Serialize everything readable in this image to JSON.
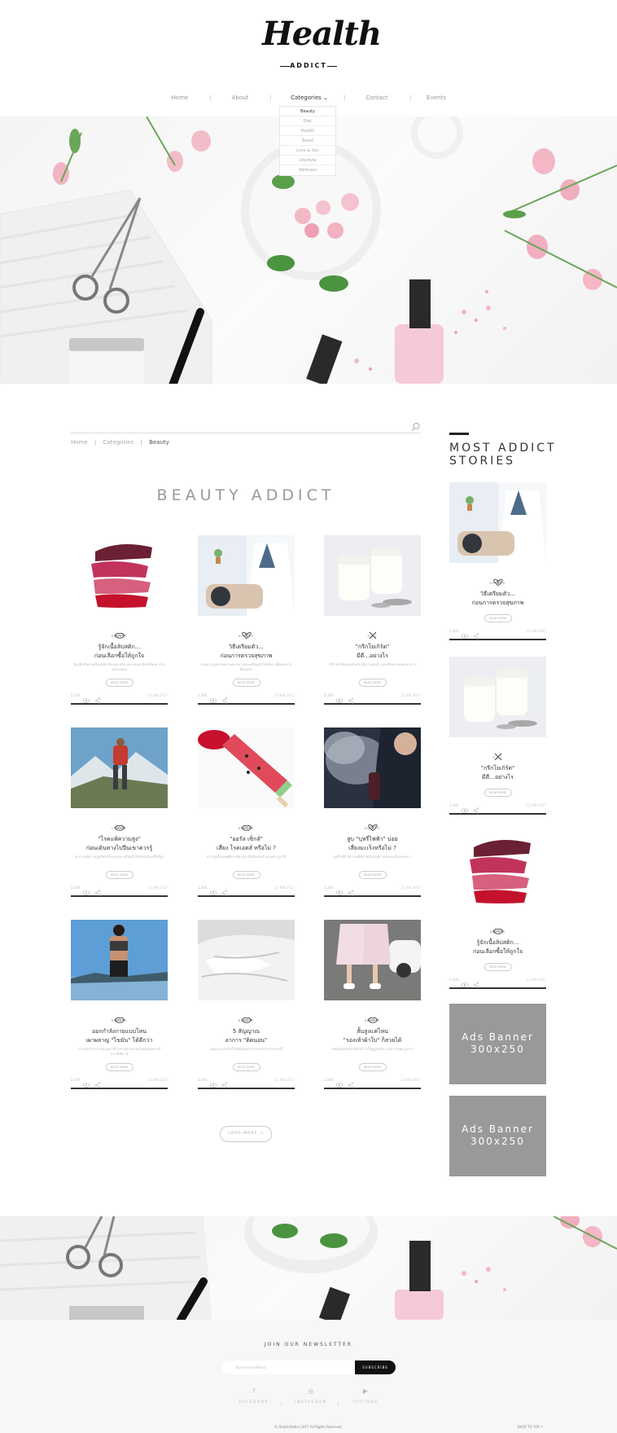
{
  "header": {
    "logo_main": "Health",
    "logo_sub": "ADDICT"
  },
  "nav": {
    "items": [
      {
        "label": "Home"
      },
      {
        "label": "About"
      },
      {
        "label": "Categories ⌄"
      },
      {
        "label": "Contact"
      },
      {
        "label": "Events"
      }
    ],
    "dropdown": [
      "Beauty",
      "Diet",
      "Health",
      "Travel",
      "Love & Sex",
      "Lifestyle",
      "Wellness"
    ]
  },
  "breadcrumb": {
    "home": "Home",
    "sep": "|",
    "categories": "Categories",
    "current": "Beauty"
  },
  "section_title": "BEAUTY ADDICT",
  "cards": [
    {
      "cat": "BEAUTY",
      "title1": "รู้จักเนื้อลิปสติก...",
      "title2": "ก่อนเลือกซื้อให้ถูกใจ",
      "desc": "ลิปสติกมีหลายเนื้อสัมผัส ทั้งแมท ครีม และกลอส เลือกให้เหมาะกับลุคของคุณ",
      "btn": "READ MORE",
      "views": "2,345",
      "date": "12 JAN 2017"
    },
    {
      "cat": "HEALTH",
      "title1": "วิธีเตรียมตัว...",
      "title2": "ก่อนการตรวจสุขภาพ",
      "desc": "ก่อนตรวจสุขภาพควรงดอาหารและเตรียมตัวให้พร้อม เพื่อผลตรวจที่แม่นยำ",
      "btn": "READ MORE",
      "views": "2,345",
      "date": "12 JAN 2017"
    },
    {
      "cat": "DIET",
      "title1": "\"กรีกโยเกิร์ต\"",
      "title2": "มีดี...อย่างไร",
      "desc": "กรีกโยเกิร์ตอุดมด้วยโปรตีน ไขมันต่ำ และดีต่อระบบย่อยอาหาร",
      "btn": "READ MORE",
      "views": "2,345",
      "date": "12 JAN 2017"
    },
    {
      "cat": "TRAVEL",
      "title1": "\"โรคแพ้ความสูง\"",
      "title2": "ก่อนเดินทางไปปีนเขาควรรู้",
      "desc": "อาการแพ้ความสูงเกิดได้กับทุกคน เตรียมตัวให้พร้อมก่อนขึ้นที่สูง",
      "btn": "READ MORE",
      "views": "2,345",
      "date": "12 JAN 2017"
    },
    {
      "cat": "BEAUTY",
      "title1": "\"ออรัล เซ็กส์\"",
      "title2": "เสี่ยง โรคเอดส์ หรือไม่ ?",
      "desc": "ความรู้เรื่องเพศศึกษาที่ควรรู้ เพื่อป้องกันตัวเองอย่างถูกวิธี",
      "btn": "READ MORE",
      "views": "2,345",
      "date": "12 JAN 2017"
    },
    {
      "cat": "HEALTH",
      "title1": "สูบ \"บุหรี่ไฟฟ้า\" บ่อย",
      "title2": "เสี่ยงมะเร็งหรือไม่ ?",
      "desc": "บุหรี่ไฟฟ้ามีสารเคมีที่อาจเป็นอันตรายต่อปอดในระยะยาว",
      "btn": "READ MORE",
      "views": "2,345",
      "date": "12 JAN 2017"
    },
    {
      "cat": "BEAUTY",
      "title1": "ออกกำลังกายแบบไหน",
      "title2": "เผาผลาญ \"ไขมัน\" ได้ดีกว่า",
      "desc": "การออกกำลังกายแบบคาร์ดิโอช่วยเผาผลาญไขมันได้อย่างมีประสิทธิภาพ",
      "btn": "READ MORE",
      "views": "2,345",
      "date": "12 JAN 2017"
    },
    {
      "cat": "BEAUTY",
      "title1": "5 สัญญาณ",
      "title2": "อาการ \"ติดนอน\"",
      "desc": "นอนมากเกินไปก็ไม่ดีต่อสุขภาพ สังเกตอาการเหล่านี้",
      "btn": "READ MORE",
      "views": "2,345",
      "date": "12 JAN 2017"
    },
    {
      "cat": "BEAUTY",
      "title1": "สั้นสูงแค่ไหน",
      "title2": "\"รองเท้าผ้าใบ\" ก็สวยได้",
      "desc": "เทคนิคแมทช์รองเท้าผ้าใบให้ดูสูงเพรียว เหมาะกับทุกรูปร่าง",
      "btn": "READ MORE",
      "views": "2,345",
      "date": "12 JAN 2017"
    }
  ],
  "load_more": "LOAD MORE  →",
  "sidebar": {
    "title": "MOST ADDICT STORIES",
    "cards": [
      {
        "cat": "HEALTH",
        "title1": "วิธีเตรียมตัว...",
        "title2": "ก่อนการตรวจสุขภาพ",
        "btn": "READ MORE",
        "views": "2,345",
        "date": "12 JAN 2017"
      },
      {
        "cat": "DIET",
        "title1": "\"กรีกโยเกิร์ต\"",
        "title2": "มีดี...อย่างไร",
        "btn": "READ MORE",
        "views": "2,345",
        "date": "12 JAN 2017"
      },
      {
        "cat": "BEAUTY",
        "title1": "รู้จักเนื้อลิปสติก...",
        "title2": "ก่อนเลือกซื้อให้ถูกใจ",
        "btn": "READ MORE",
        "views": "2,345",
        "date": "12 JAN 2017"
      }
    ],
    "ads": [
      {
        "line1": "Ads Banner",
        "line2": "300x250"
      },
      {
        "line1": "Ads Banner",
        "line2": "300x250"
      }
    ]
  },
  "footer": {
    "newsletter_title": "JOIN OUR NEWSLETTER",
    "email_placeholder": "Your email address",
    "subscribe": "SUBSCRIBE",
    "social": [
      {
        "icon": "f",
        "label": "FACEBOOK"
      },
      {
        "icon": "◎",
        "label": "INSTAGRAM"
      },
      {
        "icon": "▶",
        "label": "YOUTUBE"
      }
    ],
    "social_sep": "|",
    "copyright": "© HealthAddict 2017 All Rights Reserved.",
    "back_top": "BACK TO TOP ↑"
  },
  "colors": {
    "accent": "#111111",
    "ads_bg": "#999999",
    "footer_bg": "#f7f7f7"
  }
}
